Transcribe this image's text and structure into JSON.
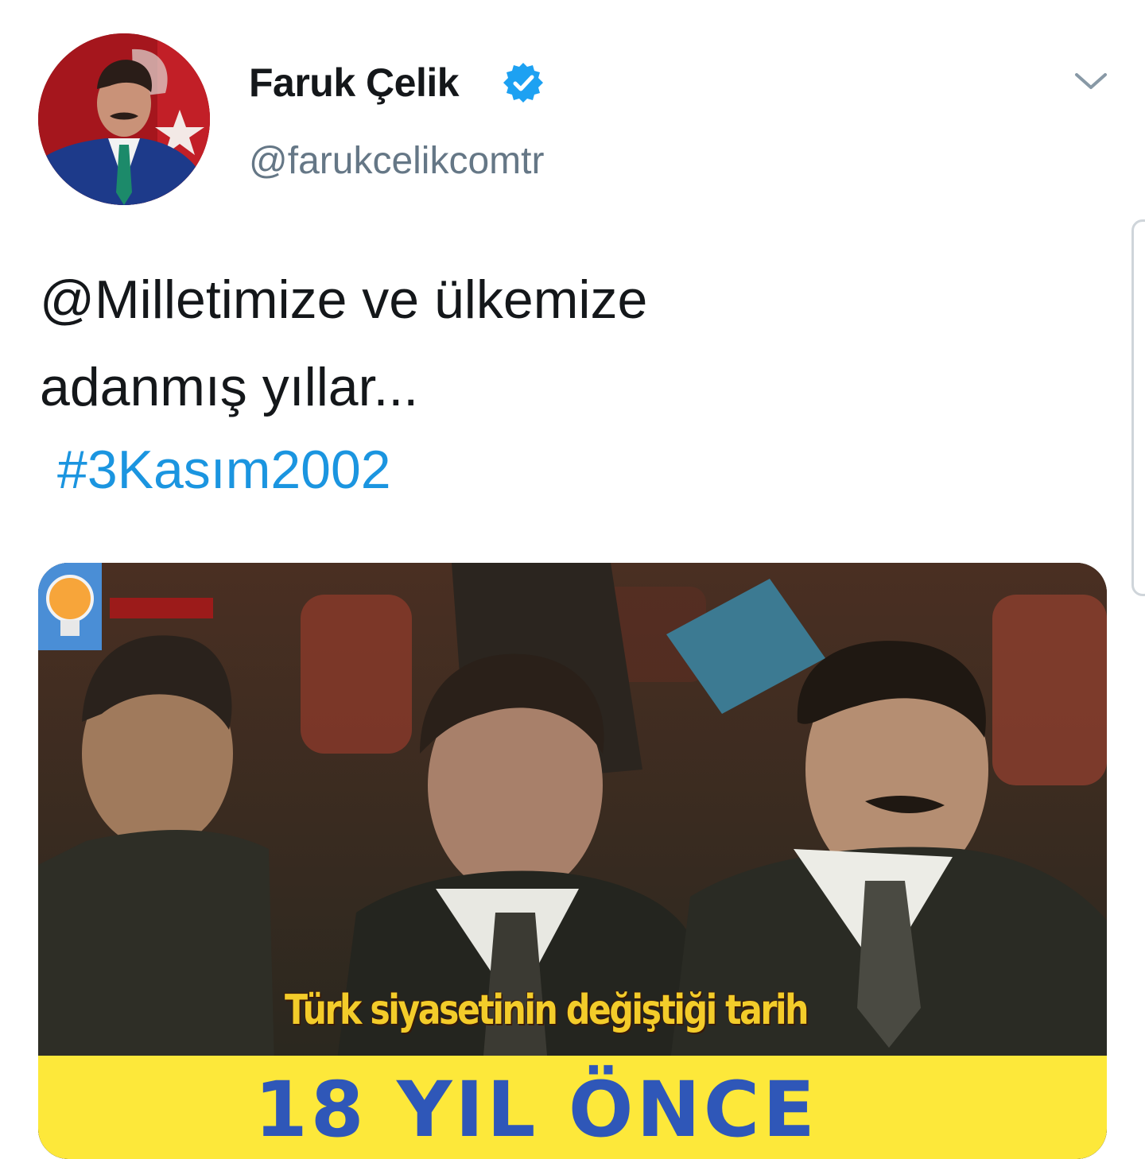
{
  "tweet": {
    "author": {
      "display_name": "Faruk Çelik",
      "handle": "@farukcelikcomtr",
      "verified": true
    },
    "text_line1": "@Milletimize ve ülkemize",
    "text_line2": "adanmış yıllar...",
    "hashtag": "#3Kasım2002",
    "media": {
      "caption_overlay": "Türk siyasetinin değiştiği tarih",
      "banner_text": "18 YIL ÖNCE"
    }
  },
  "colors": {
    "text": "#14171a",
    "secondary": "#657786",
    "link": "#1b95e0",
    "verified": "#1da1f2",
    "banner": "#fde83a",
    "banner_text": "#2f57b8"
  },
  "icons": {
    "verified": "verified-badge-icon",
    "caret": "chevron-down-icon"
  }
}
